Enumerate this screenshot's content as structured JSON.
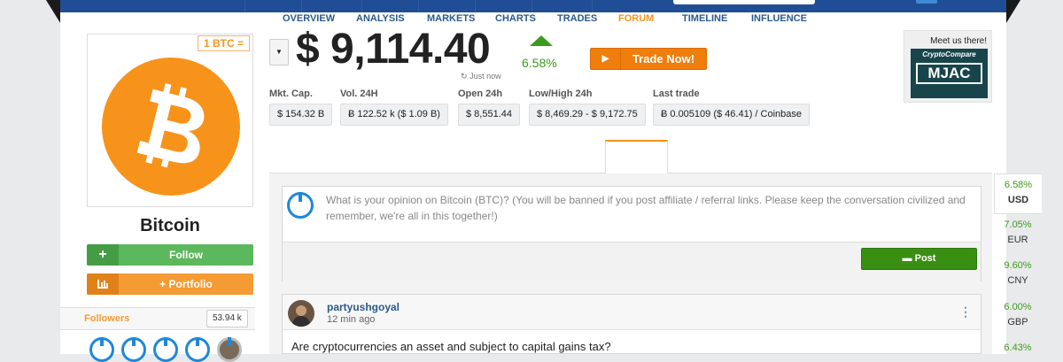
{
  "header": {},
  "coin": {
    "name": "Bitcoin",
    "unit_badge": "1 BTC =",
    "logo_color": "#f7931a",
    "logo_icon": "bitcoin-b-icon"
  },
  "actions": {
    "follow_label": "Follow",
    "follow_icon": "plus-icon",
    "portfolio_label": "+ Portfolio",
    "portfolio_icon": "bar-chart-icon"
  },
  "followers": {
    "label": "Followers",
    "count": "53.94 k"
  },
  "price": {
    "value": "$ 9,114.40",
    "updated": "Just now",
    "change_pct": "6.58%",
    "change_direction": "up",
    "up_color": "#3c9a1d"
  },
  "trade": {
    "label": "Trade Now!",
    "icon": "play-icon"
  },
  "stats": [
    {
      "label": "Mkt. Cap.",
      "value": "$ 154.32 B"
    },
    {
      "label": "Vol. 24H",
      "value": "Ƀ 122.52 k ($ 1.09 B)"
    },
    {
      "label": "Open 24h",
      "value": "$ 8,551.44"
    },
    {
      "label": "Low/High 24h",
      "value": "$ 8,469.29 - $ 9,172.75"
    },
    {
      "label": "Last trade",
      "value": "Ƀ 0.005109 ($ 46.41) / Coinbase"
    }
  ],
  "promo": {
    "label": "Meet us there!",
    "brand": "CryptoCompare",
    "event": "MJAC"
  },
  "tabs": [
    {
      "label": "OVERVIEW"
    },
    {
      "label": "ANALYSIS"
    },
    {
      "label": "MARKETS"
    },
    {
      "label": "CHARTS"
    },
    {
      "label": "TRADES"
    },
    {
      "label": "FORUM",
      "active": true
    },
    {
      "label": "TIMELINE"
    },
    {
      "label": "INFLUENCE"
    }
  ],
  "forum": {
    "compose_placeholder": "What is your opinion on Bitcoin (BTC)? (You will be banned if you post affiliate / referral links. Please keep the conversation civilized and remember, we're all in this together!)",
    "post_label": "Post",
    "post_icon": "comment-icon",
    "posts": [
      {
        "user": "partyushgoyal",
        "time": "12 min ago",
        "body": "Are cryptocurrencies an asset and subject to capital gains tax?"
      }
    ]
  },
  "currencies": [
    {
      "pct": "6.58%",
      "code": "USD",
      "active": true
    },
    {
      "pct": "7.05%",
      "code": "EUR"
    },
    {
      "pct": "9.60%",
      "code": "CNY"
    },
    {
      "pct": "6.00%",
      "code": "GBP"
    },
    {
      "pct": "6.43%",
      "code": ""
    }
  ]
}
